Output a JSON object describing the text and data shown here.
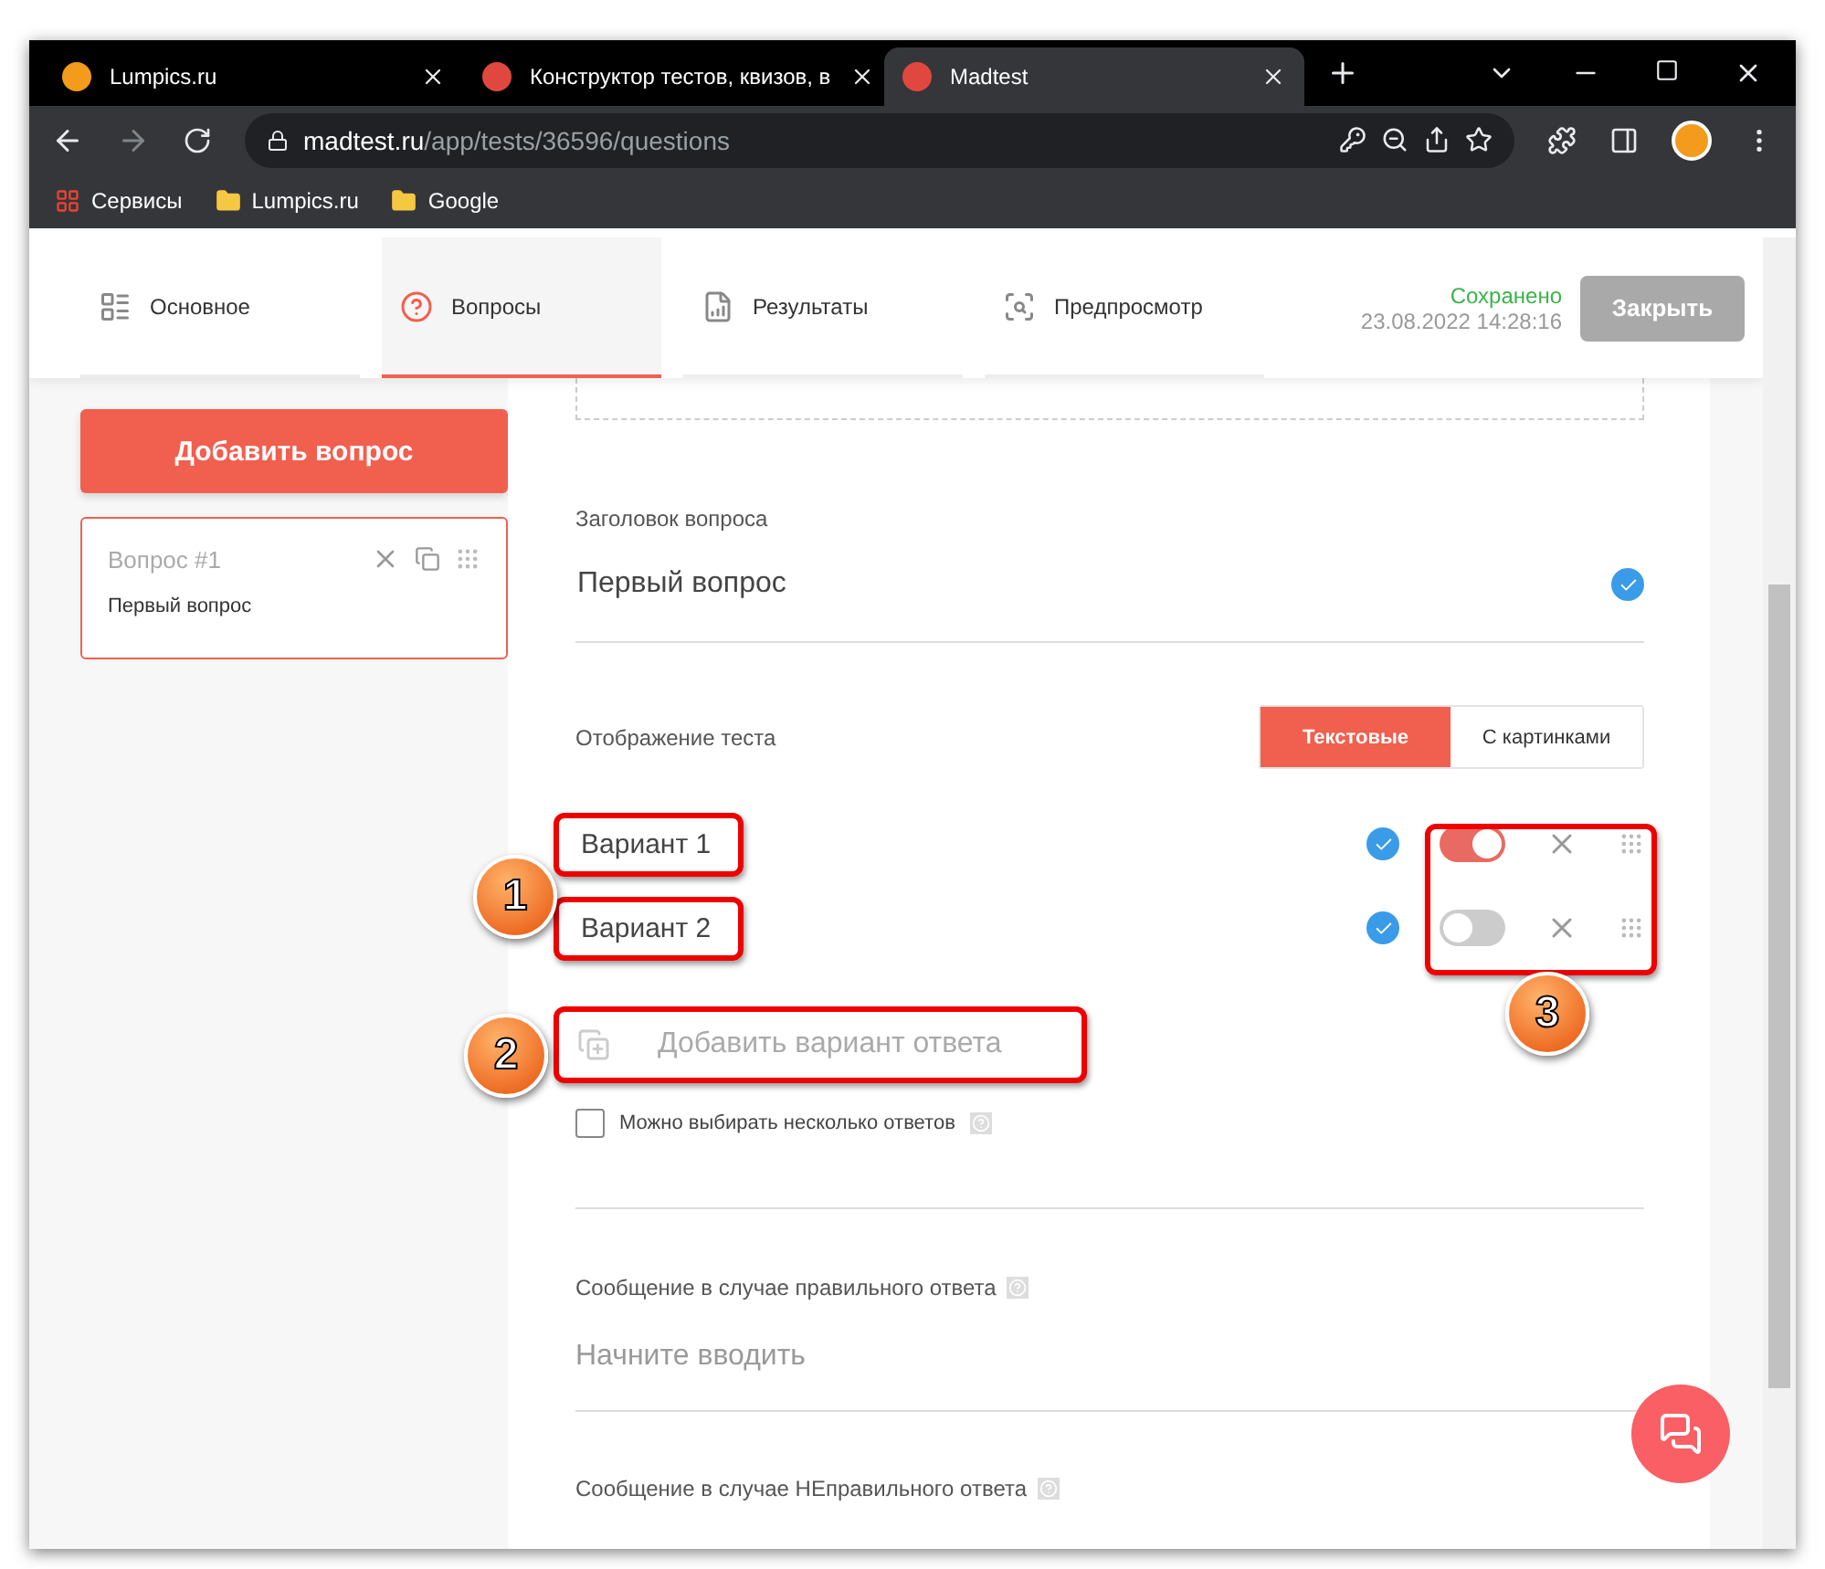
{
  "browser": {
    "tabs": [
      {
        "title": "Lumpics.ru",
        "selected": false
      },
      {
        "title": "Конструктор тестов, квизов, в",
        "selected": false
      },
      {
        "title": "Madtest",
        "selected": true
      }
    ],
    "url_host": "madtest.ru",
    "url_path": "/app/tests/36596/questions",
    "bookmarks": [
      "Сервисы",
      "Lumpics.ru",
      "Google"
    ]
  },
  "app_tabs": [
    {
      "label": "Основное",
      "selected": false
    },
    {
      "label": "Вопросы",
      "selected": true
    },
    {
      "label": "Результаты",
      "selected": false
    },
    {
      "label": "Предпросмотр",
      "selected": false
    }
  ],
  "save_status": {
    "label": "Сохранено",
    "time": "23.08.2022 14:28:16"
  },
  "close_button": "Закрыть",
  "sidebar": {
    "add_button": "Добавить вопрос",
    "questions": [
      {
        "number": "Вопрос #1",
        "title": "Первый вопрос",
        "selected": true
      }
    ]
  },
  "question": {
    "title_label": "Заголовок вопроса",
    "title_value": "Первый вопрос",
    "display_label": "Отображение теста",
    "display_modes": [
      {
        "label": "Текстовые",
        "selected": true
      },
      {
        "label": "С картинками",
        "selected": false
      }
    ],
    "answers": [
      {
        "text": "Вариант 1",
        "correct": true
      },
      {
        "text": "Вариант 2",
        "correct": false
      }
    ],
    "add_answer": "Добавить вариант ответа",
    "multiple": {
      "label": "Можно выбирать несколько ответов",
      "checked": false
    },
    "correct_message": {
      "label": "Сообщение в случае правильного ответа",
      "placeholder": "Начните вводить"
    },
    "wrong_message": {
      "label": "Сообщение в случае НЕправильного ответа"
    }
  },
  "annotations": [
    "1",
    "2",
    "3"
  ]
}
